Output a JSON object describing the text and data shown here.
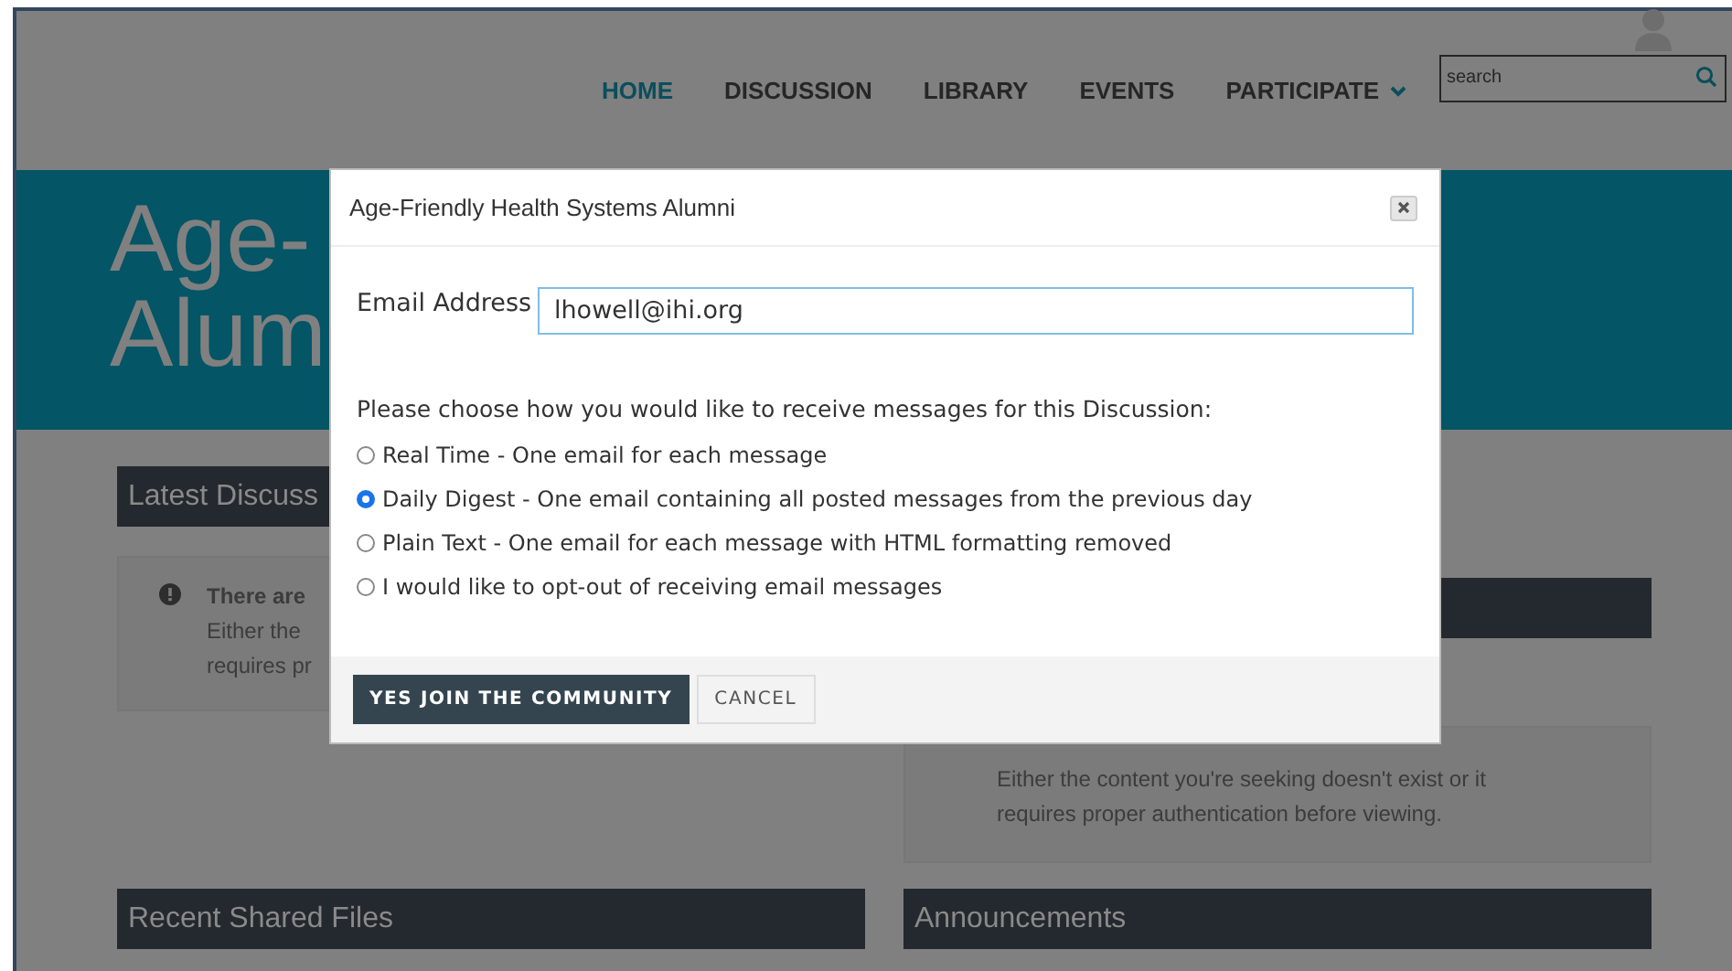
{
  "nav": {
    "items": [
      {
        "label": "HOME",
        "selected": true,
        "has_menu": false
      },
      {
        "label": "DISCUSSION",
        "selected": false,
        "has_menu": false
      },
      {
        "label": "LIBRARY",
        "selected": false,
        "has_menu": false
      },
      {
        "label": "EVENTS",
        "selected": false,
        "has_menu": false
      },
      {
        "label": "PARTICIPATE",
        "selected": false,
        "has_menu": true
      }
    ]
  },
  "search": {
    "placeholder": "search"
  },
  "hero": {
    "lines": [
      "Age-",
      "Alum"
    ]
  },
  "left_panel": {
    "title": "Latest Discuss",
    "alert": {
      "title": "There are",
      "lines": [
        "Either the",
        "requires pr"
      ]
    }
  },
  "right_panel": {
    "alert": {
      "lines": [
        "Either the content you're seeking doesn't exist or it",
        "requires proper authentication before viewing."
      ]
    }
  },
  "bottom_panels": [
    {
      "title": "Recent Shared Files"
    },
    {
      "title": "Announcements"
    }
  ],
  "modal": {
    "title": "Age-Friendly Health Systems Alumni",
    "email": {
      "label": "Email Address",
      "value": "lhowell@ihi.org"
    },
    "prompt": "Please choose how you would like to receive messages for this Discussion:",
    "options": [
      {
        "label": "Real Time - One email for each message",
        "selected": false
      },
      {
        "label": "Daily Digest - One email containing all posted messages from the previous day",
        "selected": true
      },
      {
        "label": "Plain Text - One email for each message with HTML formatting removed",
        "selected": false
      },
      {
        "label": "I would like to opt-out of receiving email messages",
        "selected": false
      }
    ],
    "buttons": [
      {
        "label": "YES JOIN THE COMMUNITY",
        "kind": "primary"
      },
      {
        "label": "CANCEL",
        "kind": "secondary"
      }
    ]
  }
}
